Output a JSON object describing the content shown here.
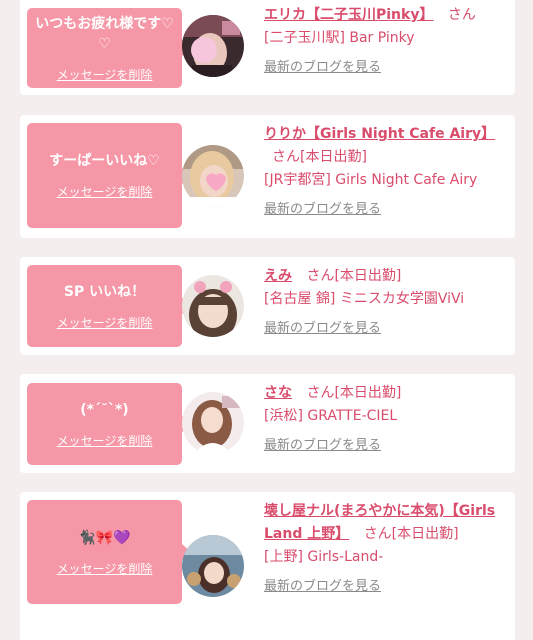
{
  "delete_label": "メッセージを削除",
  "blog_label": "最新のブログを見る",
  "accent": "#d94c6b",
  "bubble_color": "#f597a6",
  "entries": [
    {
      "message": "いつもお疲れ様です♡♡",
      "name": "エリカ【二子玉川Pinky】",
      "suffix": "さん",
      "shop": "[二子玉川駅] Bar Pinky"
    },
    {
      "message": "すーぱーいいね♡",
      "name": "りりか【Girls Night Cafe Airy】",
      "suffix": "さん[本日出勤]",
      "shop": "[JR宇都宮] Girls Night Cafe Airy"
    },
    {
      "message": "SP いいね！",
      "name": "えみ",
      "suffix": "さん[本日出勤]",
      "shop": "[名古屋 錦] ミニスカ女学園ViVi"
    },
    {
      "message": "(*´˘`*)",
      "name": "さな",
      "suffix": "さん[本日出勤]",
      "shop": "[浜松] GRATTE-CIEL"
    },
    {
      "message": "🐈‍⬛🎀💜",
      "name": "壊し屋ナル(まろやかに本気)【Girls Land 上野】",
      "suffix": "さん[本日出勤]",
      "shop": "[上野] Girls-Land-"
    }
  ]
}
